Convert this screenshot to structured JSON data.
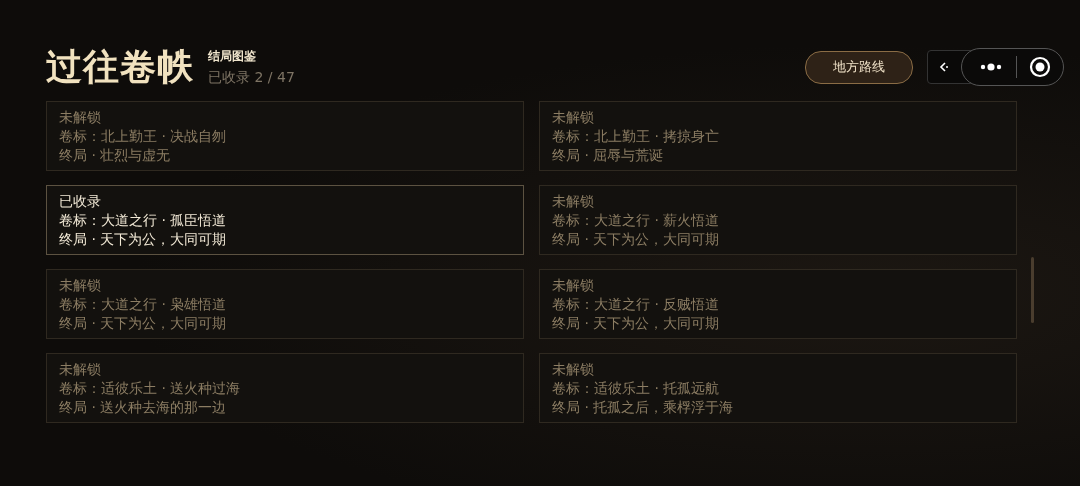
{
  "header": {
    "title": "过往卷帙",
    "subtitle": "结局图鉴",
    "progress": "已收录 2 / 47"
  },
  "route_button": "地方路线",
  "endings": [
    {
      "status": "未解锁",
      "volume": "卷标：北上勤王 · 决战自刎",
      "ending": "终局 · 壮烈与虚无",
      "unlocked": false
    },
    {
      "status": "未解锁",
      "volume": "卷标：北上勤王 · 拷掠身亡",
      "ending": "终局 · 屈辱与荒诞",
      "unlocked": false
    },
    {
      "status": "已收录",
      "volume": "卷标：大道之行 · 孤臣悟道",
      "ending": "终局 · 天下为公，大同可期",
      "unlocked": true
    },
    {
      "status": "未解锁",
      "volume": "卷标：大道之行 · 薪火悟道",
      "ending": "终局 · 天下为公，大同可期",
      "unlocked": false
    },
    {
      "status": "未解锁",
      "volume": "卷标：大道之行 · 枭雄悟道",
      "ending": "终局 · 天下为公，大同可期",
      "unlocked": false
    },
    {
      "status": "未解锁",
      "volume": "卷标：大道之行 · 反贼悟道",
      "ending": "终局 · 天下为公，大同可期",
      "unlocked": false
    },
    {
      "status": "未解锁",
      "volume": "卷标：适彼乐土 · 送火种过海",
      "ending": "终局 · 送火种去海的那一边",
      "unlocked": false
    },
    {
      "status": "未解锁",
      "volume": "卷标：适彼乐土 · 托孤远航",
      "ending": "终局 · 托孤之后，乘桴浮于海",
      "unlocked": false
    }
  ]
}
